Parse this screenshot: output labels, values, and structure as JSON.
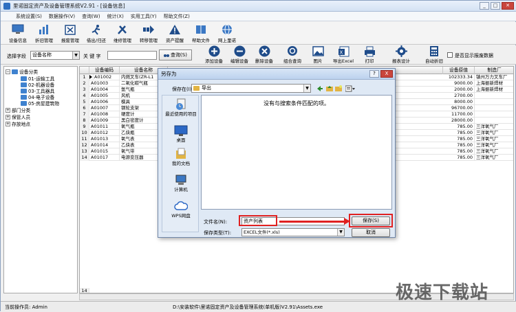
{
  "window": {
    "title": "里诺固定资产及设备管理系统V2.91 - [设备信息]"
  },
  "menu": [
    "系统设置(S)",
    "数据操作(V)",
    "查询(W)",
    "统计(X)",
    "实用工具(Y)",
    "帮助文件(Z)"
  ],
  "toolbar1": [
    {
      "label": "设备信息",
      "icon": "monitor-icon"
    },
    {
      "label": "折旧管理",
      "icon": "bar-chart-icon"
    },
    {
      "label": "报废管理",
      "icon": "trash-box-icon"
    },
    {
      "label": "借出/归还",
      "icon": "running-person-icon"
    },
    {
      "label": "维修管理",
      "icon": "wrench-icon"
    },
    {
      "label": "转移管理",
      "icon": "arrow-right-icon"
    },
    {
      "label": "资产提醒",
      "icon": "warning-icon"
    },
    {
      "label": "帮助文件",
      "icon": "book-icon"
    },
    {
      "label": "网上里诺",
      "icon": "globe-icon"
    }
  ],
  "search": {
    "field_label": "选择字段",
    "field_value": "设备名称",
    "keyword_label": "关 键 字",
    "keyword_value": "",
    "query_label": "查询(S)"
  },
  "toolbar2": [
    {
      "label": "添加设备",
      "icon": "add-circle-icon"
    },
    {
      "label": "编辑设备",
      "icon": "minus-circle-icon"
    },
    {
      "label": "删除设备",
      "icon": "delete-circle-icon"
    },
    {
      "label": "组合查询",
      "icon": "magnifier-icon"
    },
    {
      "label": "图片",
      "icon": "picture-icon"
    },
    {
      "label": "导出Excel",
      "icon": "excel-icon"
    },
    {
      "label": "打印",
      "icon": "printer-icon"
    },
    {
      "label": "报表设计",
      "icon": "gear-icon"
    },
    {
      "label": "自动折旧",
      "icon": "calculator-icon"
    }
  ],
  "show_scrapped_label": "是否显示报废数据",
  "tree": {
    "root": "设备分类",
    "children": [
      "01-运输工具",
      "02-机器设备",
      "03-工具器具",
      "04-电子设备",
      "05-房屋建筑物"
    ],
    "others": [
      "部门分类",
      "保管人员",
      "存放地点"
    ]
  },
  "grid": {
    "headers": [
      "设备编码",
      "设备名称",
      "设备原值",
      "制造厂"
    ],
    "rows": [
      {
        "n": "1",
        "code": "A01002",
        "name": "内燃叉车(ZR-L1",
        "value": "102333.34",
        "maker": "镇州万力叉车厂"
      },
      {
        "n": "2",
        "code": "A01003",
        "name": "二氧化碳气瓶",
        "value": "9000.00",
        "maker": "上海振新焊材"
      },
      {
        "n": "3",
        "code": "A01004",
        "name": "氩气瓶",
        "value": "2000.00",
        "maker": "上海振新焊材"
      },
      {
        "n": "4",
        "code": "A01005",
        "name": "风机",
        "value": "2700.00",
        "maker": ""
      },
      {
        "n": "5",
        "code": "A01006",
        "name": "模具",
        "value": "8000.00",
        "maker": ""
      },
      {
        "n": "6",
        "code": "A01007",
        "name": "钢轮支架",
        "value": "96700.00",
        "maker": ""
      },
      {
        "n": "7",
        "code": "A01008",
        "name": "硬度计",
        "value": "11700.00",
        "maker": ""
      },
      {
        "n": "8",
        "code": "A01009",
        "name": "黑白密度计",
        "value": "28000.00",
        "maker": ""
      },
      {
        "n": "9",
        "code": "A01011",
        "name": "氧气瓶",
        "value": "785.00",
        "maker": "三洋氧气厂"
      },
      {
        "n": "10",
        "code": "A01012",
        "name": "乙炔瓶",
        "value": "785.00",
        "maker": "三洋氧气厂"
      },
      {
        "n": "11",
        "code": "A01013",
        "name": "氧气表",
        "value": "785.00",
        "maker": "三洋氧气厂"
      },
      {
        "n": "12",
        "code": "A01014",
        "name": "乙炔表",
        "value": "785.00",
        "maker": "三洋氧气厂"
      },
      {
        "n": "13",
        "code": "A01015",
        "name": "氧气带",
        "value": "785.00",
        "maker": "三洋氧气厂"
      },
      {
        "n": "14",
        "code": "A01017",
        "name": "电源变压器",
        "value": "785.00",
        "maker": "三洋氧气厂"
      }
    ],
    "footer_row_num": "14"
  },
  "status": {
    "operator": "当前操作员: Admin",
    "path": "D:\\安装软件\\里诺固定资产及设备管理系统(单机版)V2.91\\Assets.exe"
  },
  "dialog": {
    "title": "另存为",
    "save_in_label": "保存在(I):",
    "save_in_value": "导出",
    "empty_msg": "没有与搜索条件匹配的项。",
    "places": [
      {
        "label": "最近使用的项目",
        "icon": "recent-items-icon"
      },
      {
        "label": "桌面",
        "icon": "desktop-icon"
      },
      {
        "label": "我的文档",
        "icon": "documents-icon"
      },
      {
        "label": "计算机",
        "icon": "computer-icon"
      },
      {
        "label": "WPS网盘",
        "icon": "cloud-icon"
      }
    ],
    "filename_label": "文件名(N):",
    "filename_value": "资产列表",
    "filetype_label": "保存类型(T):",
    "filetype_value": "EXCEL文件(*.xls)",
    "save_label": "保存(S)",
    "cancel_label": "取消",
    "help": "?",
    "close": "X"
  },
  "watermark": "极速下载站",
  "colors": {
    "highlight": "#e02020",
    "titlebar": "#d4e2f3",
    "folder": "#e2b443"
  }
}
